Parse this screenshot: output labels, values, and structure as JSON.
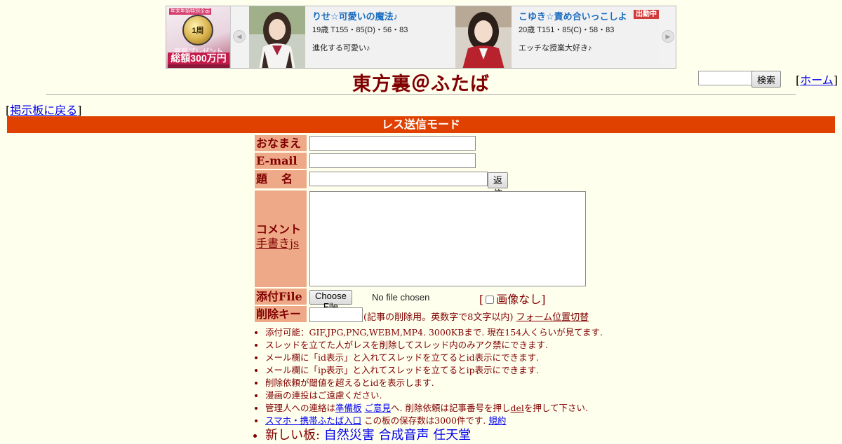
{
  "banner": {
    "badge": {
      "tag": "年末年始特別企画",
      "medal": "1周",
      "line1": "豪華プレゼント",
      "line2": "総額300万円"
    },
    "prev_icon": "chevron-left-icon",
    "next_icon": "chevron-right-icon",
    "cards": [
      {
        "name": "りせ☆可愛いの魔法♪",
        "stats": "19歳 T155・85(D)・56・83",
        "catch": "進化する可愛い♪"
      },
      {
        "name": "こゆき☆責め合いっこしよ",
        "stats": "20歳 T151・85(C)・58・83",
        "catch": "エッチな授業大好き♪",
        "badge": "出動中"
      }
    ]
  },
  "header": {
    "title": "東方裏＠ふたば",
    "search_button": "検索",
    "home_link": "ホーム",
    "back_link": "掲示板に戻る"
  },
  "mode_bar": "レス送信モード",
  "form": {
    "name_label": "おなまえ",
    "email_label": "E-mail",
    "subject_label": "題　名",
    "submit_button": "返信する",
    "comment_label": "コメント",
    "handwriting_link": "手書きjs",
    "file_label": "添付File",
    "file_button": "Choose File",
    "file_status": "No file chosen",
    "no_image_label": "画像なし",
    "delkey_label": "削除キー",
    "delkey_note": "(記事の削除用。英数字で8文字以内)",
    "form_toggle_link": "フォーム位置切替"
  },
  "notes": {
    "n1": "添付可能：GIF,JPG,PNG,WEBM,MP4. 3000KBまで. 現在154人くらいが見てます.",
    "n2": "スレッドを立てた人がレスを削除してスレッド内のみアク禁にできます.",
    "n3": "メール欄に「id表示」と入れてスレッドを立てるとid表示にできます.",
    "n4": "メール欄に「ip表示」と入れてスレッドを立てるとip表示にできます.",
    "n5": "削除依頼が閾値を超えるとidを表示します.",
    "n6": "漫画の連投はご遠慮ください.",
    "n7": {
      "prefix": "管理人への連絡は",
      "link1": "準備板",
      "link2": "ご意見",
      "mid": "へ. 削除依頼は記事番号を押し",
      "link3": "del",
      "suffix": "を押して下さい."
    },
    "n8": {
      "link": "スマホ・携帯ふたば入口",
      "text": " この板の保存数は3000件です. ",
      "link2": "規約"
    },
    "n9": {
      "prefix": "新しい板: ",
      "links": [
        "自然災害",
        "合成音声",
        "任天堂"
      ]
    }
  },
  "colors": {
    "background": "#ffffee",
    "text": "#800000",
    "label_bg": "#eeaa88",
    "mode_bar": "#e04000",
    "link": "#0000ee"
  }
}
